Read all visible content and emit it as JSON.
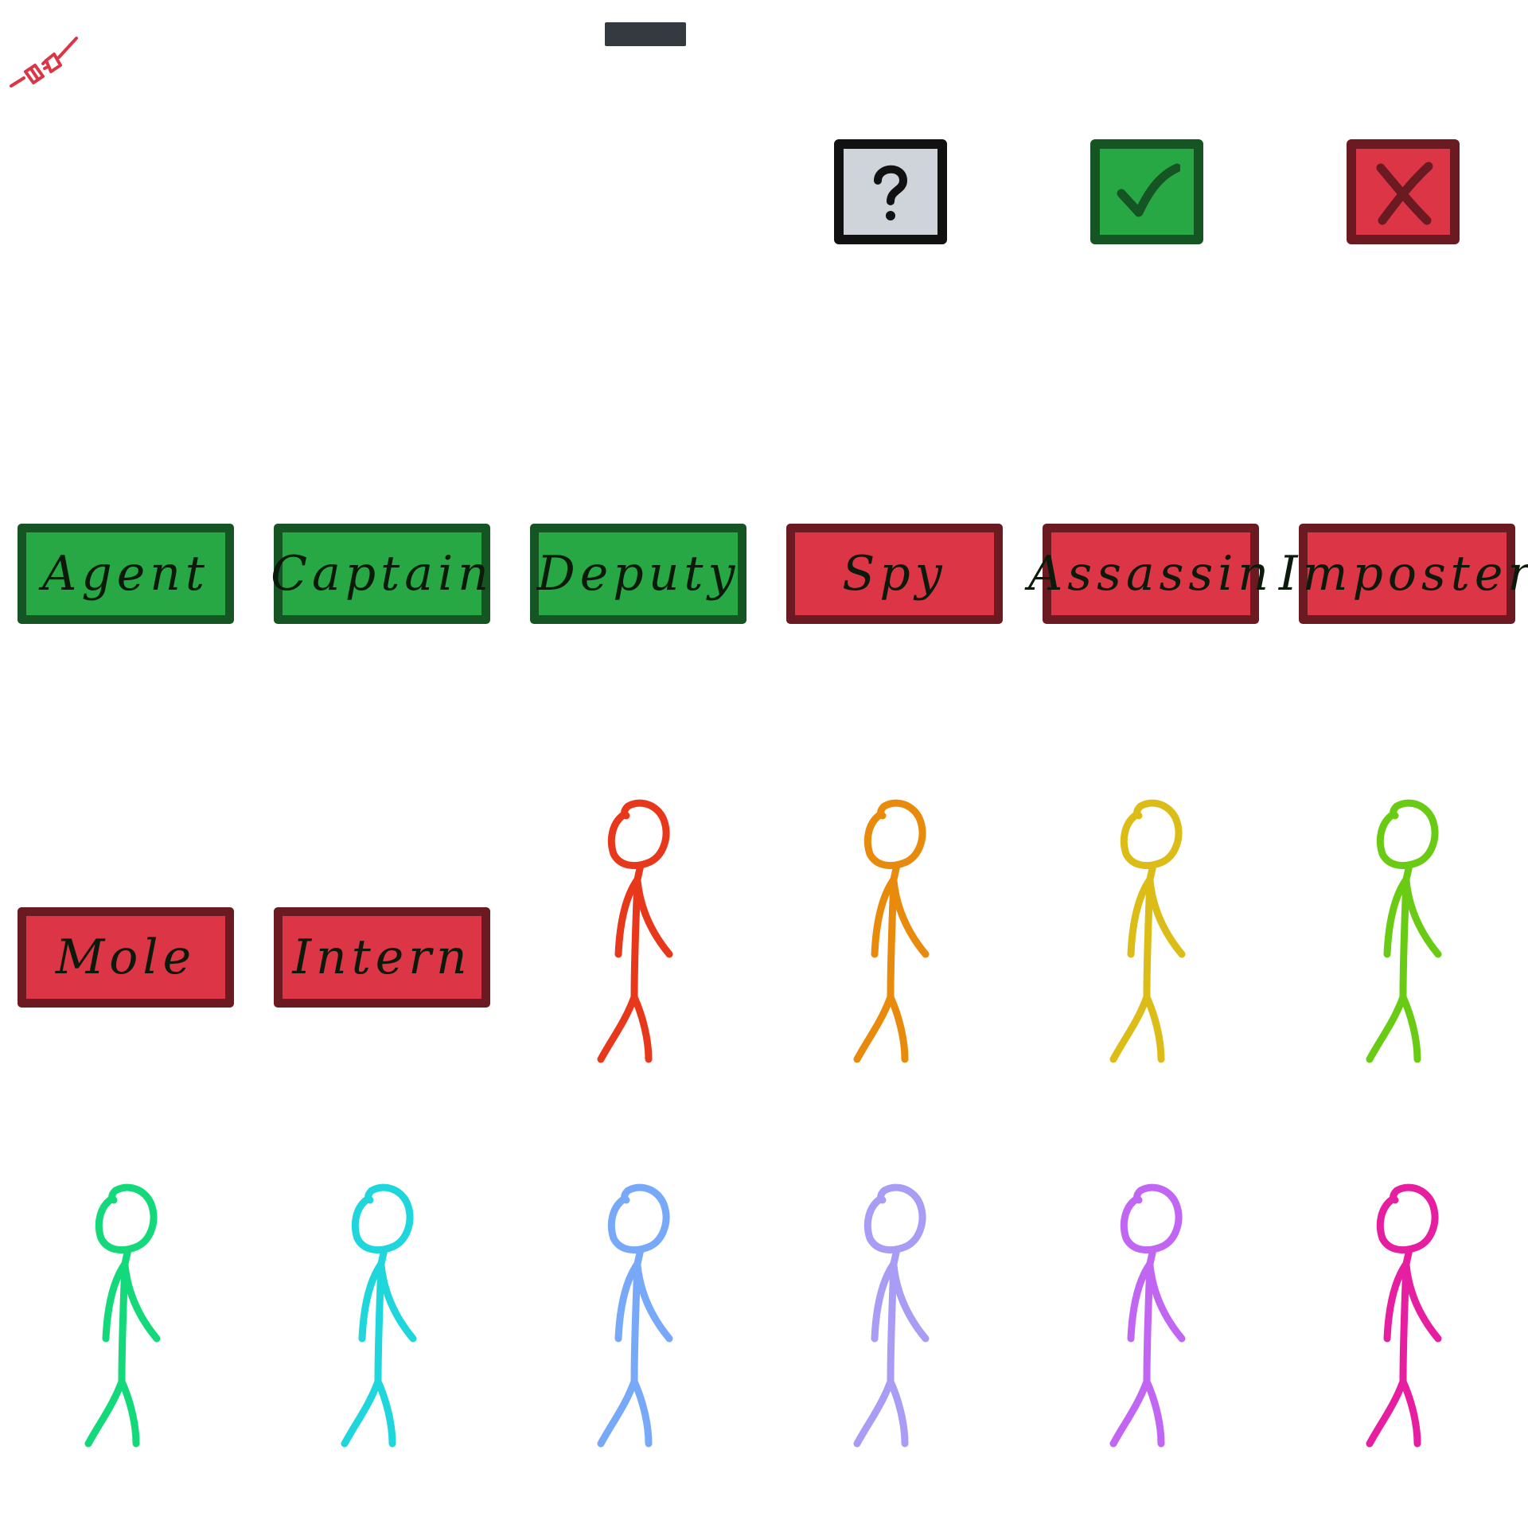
{
  "status": {
    "icon": "disconnected-plug-icon",
    "color": "#dc3545"
  },
  "top_bar": {
    "color": "#343a40"
  },
  "action_buttons": [
    {
      "name": "help-button",
      "icon": "question-mark-icon",
      "bg": "#ced4da",
      "border": "#111111"
    },
    {
      "name": "confirm-button",
      "icon": "checkmark-icon",
      "bg": "#28a745",
      "border": "#145523"
    },
    {
      "name": "cancel-button",
      "icon": "x-icon",
      "bg": "#dc3545",
      "border": "#6b1a22"
    }
  ],
  "roles": [
    {
      "label": "Agent",
      "team": "good"
    },
    {
      "label": "Captain",
      "team": "good"
    },
    {
      "label": "Deputy",
      "team": "good"
    },
    {
      "label": "Spy",
      "team": "bad"
    },
    {
      "label": "Assassin",
      "team": "bad"
    },
    {
      "label": "Imposter",
      "team": "bad"
    },
    {
      "label": "Mole",
      "team": "bad"
    },
    {
      "label": "Intern",
      "team": "bad"
    }
  ],
  "team_colors": {
    "good": {
      "bg": "#28a745",
      "border": "#145523"
    },
    "bad": {
      "bg": "#dc3545",
      "border": "#6b1a22"
    }
  },
  "players": [
    {
      "color": "#e8381c"
    },
    {
      "color": "#e88a0c"
    },
    {
      "color": "#dcbd18"
    },
    {
      "color": "#6acb14"
    },
    {
      "color": "#14d97a"
    },
    {
      "color": "#1ed6dc"
    },
    {
      "color": "#78a8f8"
    },
    {
      "color": "#a89cf4"
    },
    {
      "color": "#c166f2"
    },
    {
      "color": "#e61ea0"
    }
  ]
}
